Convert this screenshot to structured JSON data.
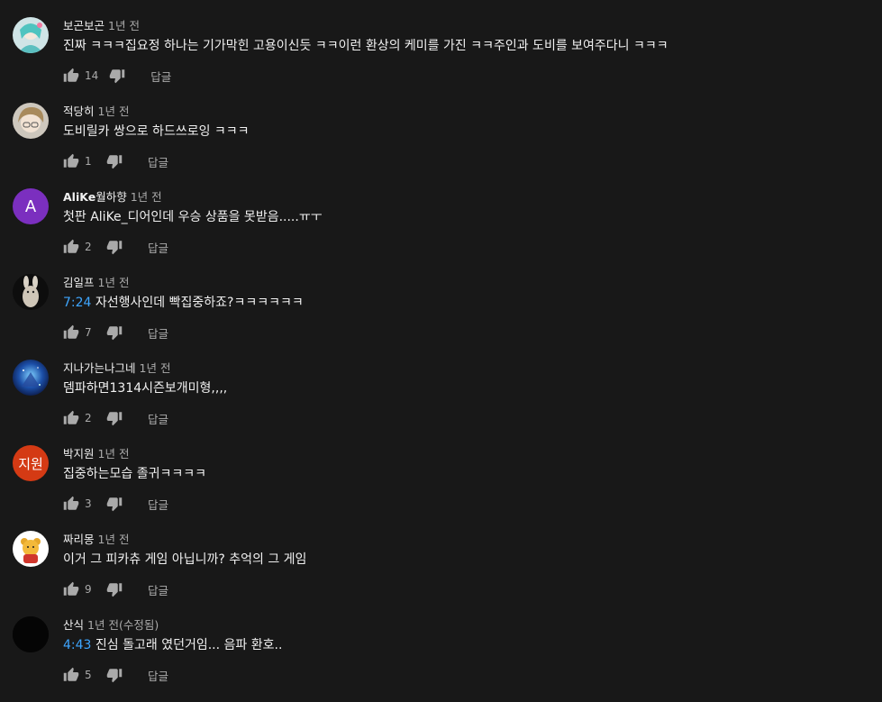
{
  "reply_label": "답글",
  "colors": {
    "background": "#181818",
    "text": "#f1f1f1",
    "muted": "#aaaaaa",
    "timestamp_link": "#3ea6ff"
  },
  "comments": [
    {
      "author": "보곤보곤",
      "time": "1년 전",
      "text": "진짜 ㅋㅋㅋ집요정 하나는 기가막힌 고용이신듯 ㅋㅋ이런 환상의 케미를 가진 ㅋㅋ주인과 도비를 보여주다니 ㅋㅋㅋ",
      "likes": "14",
      "avatar": "teal-character-avatar"
    },
    {
      "author": "적당히",
      "time": "1년 전",
      "text": "도비릴카 쌍으로 하드쓰로잉 ㅋㅋㅋ",
      "likes": "1",
      "avatar": "anime-character-avatar"
    },
    {
      "author": "AliKe",
      "author_suffix": "월하향",
      "time": "1년 전",
      "text": "첫판 AliKe_디어인데 우승 상품을 못받음.....ㅠㅜ",
      "likes": "2",
      "avatar_letter": "A",
      "avatar_color": "#7b2fbf"
    },
    {
      "author": "김일프",
      "time": "1년 전",
      "timestamp": "7:24",
      "text": " 자선행사인데 빡집중하죠?ㅋㅋㅋㅋㅋㅋ",
      "likes": "7",
      "avatar": "rabbit-avatar"
    },
    {
      "author": "지나가는나그네",
      "time": "1년 전",
      "text": "뎀파하면1314시즌보개미형,,,,",
      "likes": "2",
      "avatar": "blue-space-avatar"
    },
    {
      "author": "박지원",
      "time": "1년 전",
      "text": "집중하는모습 졸귀ㅋㅋㅋㅋ",
      "likes": "3",
      "avatar_letter": "지원",
      "avatar_color": "#d43a14"
    },
    {
      "author": "짜리몽",
      "time": "1년 전",
      "text": "이거 그 피카츄 게임 아닙니까? 추억의 그 게임",
      "likes": "9",
      "avatar": "bear-avatar"
    },
    {
      "author": "산식",
      "time": "1년 전(수정됨)",
      "timestamp": "4:43",
      "text": " 진심 돌고래 였던거임... 음파 환호..",
      "likes": "5",
      "avatar": "black-avatar"
    }
  ]
}
